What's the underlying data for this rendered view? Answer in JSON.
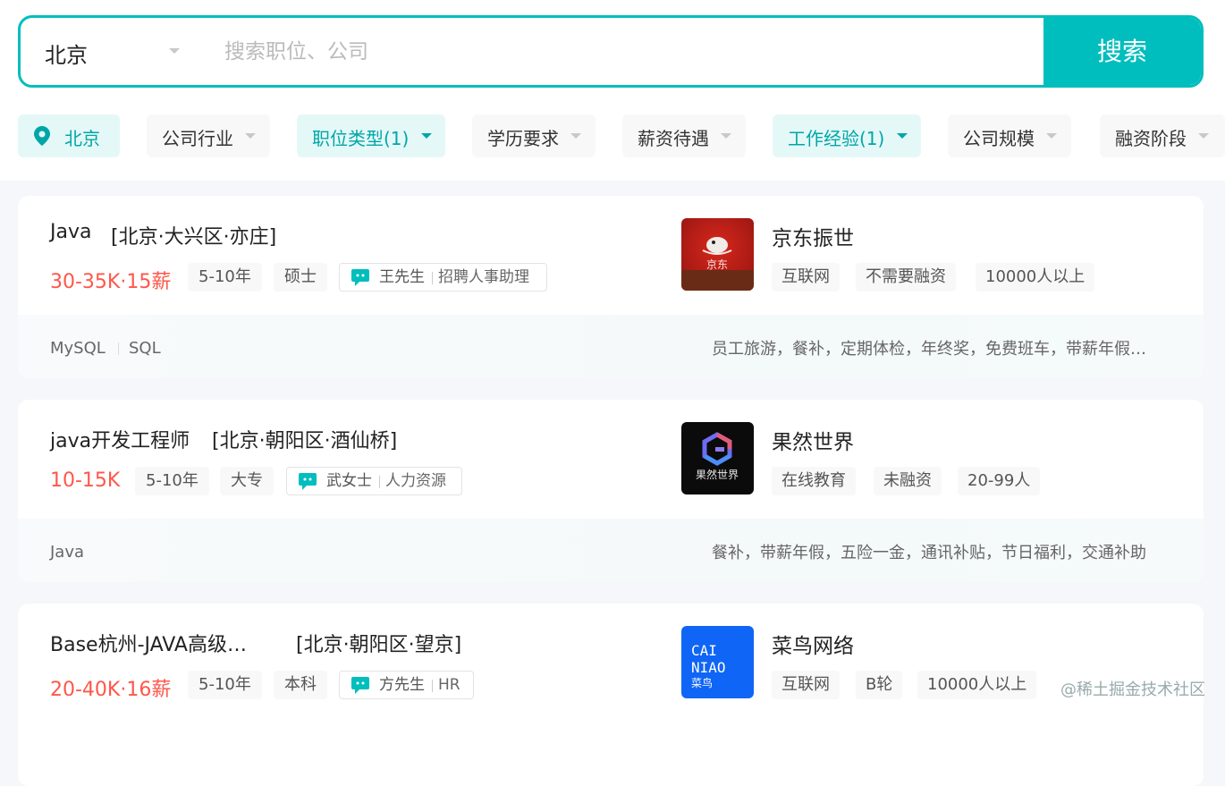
{
  "search": {
    "city": "北京",
    "placeholder": "搜索职位、公司",
    "value": "",
    "button_label": "搜索"
  },
  "filters": [
    {
      "label": "北京",
      "active": true,
      "icon": "location-pin-icon"
    },
    {
      "label": "公司行业",
      "active": false
    },
    {
      "label": "职位类型(1)",
      "active": true
    },
    {
      "label": "学历要求",
      "active": false
    },
    {
      "label": "薪资待遇",
      "active": false
    },
    {
      "label": "工作经验(1)",
      "active": true
    },
    {
      "label": "公司规模",
      "active": false
    },
    {
      "label": "融资阶段",
      "active": false
    }
  ],
  "jobs": [
    {
      "title": "Java",
      "area": "[北京·大兴区·亦庄]",
      "salary": "30-35K·15薪",
      "tags": [
        "5-10年",
        "硕士"
      ],
      "boss_name": "王先生",
      "boss_title": "招聘人事助理",
      "company": "京东振世",
      "company_logo": "jd-logo",
      "company_tags": [
        "互联网",
        "不需要融资",
        "10000人以上"
      ],
      "skills": [
        "MySQL",
        "SQL"
      ],
      "welfare": "员工旅游，餐补，定期体检，年终奖，免费班车，带薪年假…",
      "logo_text": "京东"
    },
    {
      "title": "java开发工程师",
      "area": "[北京·朝阳区·酒仙桥]",
      "salary": "10-15K",
      "tags": [
        "5-10年",
        "大专"
      ],
      "boss_name": "武女士",
      "boss_title": "人力资源",
      "company": "果然世界",
      "company_logo": "guoranshijie-logo",
      "company_tags": [
        "在线教育",
        "未融资",
        "20-99人"
      ],
      "skills": [
        "Java"
      ],
      "welfare": "餐补，带薪年假，五险一金，通讯补贴，节日福利，交通补助",
      "logo_text": "果然世界"
    },
    {
      "title": "Base杭州-JAVA高级…",
      "area": "[北京·朝阳区·望京]",
      "salary": "20-40K·16薪",
      "tags": [
        "5-10年",
        "本科"
      ],
      "boss_name": "方先生",
      "boss_title": "HR",
      "company": "菜鸟网络",
      "company_logo": "cainiao-logo",
      "company_tags": [
        "互联网",
        "B轮",
        "10000人以上"
      ],
      "skills": [],
      "welfare": "",
      "logo_text_1": "CAI",
      "logo_text_2": "NIAO",
      "logo_text_3": "菜鸟"
    }
  ],
  "watermark": "@稀土掘金技术社区",
  "colors": {
    "accent": "#00bebd",
    "accent_text": "#00a6a7",
    "salary": "#fe574a",
    "active_filter_bg": "#e5f8f8"
  }
}
